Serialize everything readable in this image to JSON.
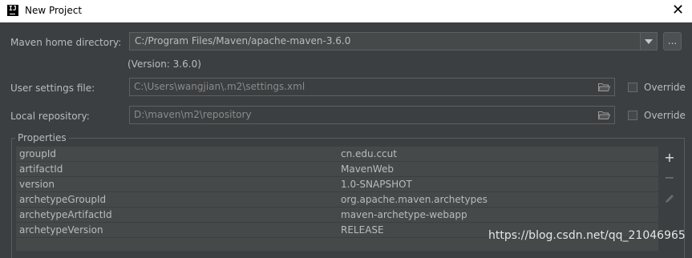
{
  "window": {
    "title": "New Project",
    "app_icon": "IJ"
  },
  "maven_home": {
    "label": "Maven home directory:",
    "value": "C:/Program Files/Maven/apache-maven-3.6.0",
    "version_note": "(Version: 3.6.0)",
    "browse_label": "..."
  },
  "user_settings": {
    "label": "User settings file:",
    "value": "C:\\Users\\wangjian\\.m2\\settings.xml",
    "override_label": "Override",
    "override_checked": false
  },
  "local_repo": {
    "label": "Local repository:",
    "value": "D:\\maven\\m2\\repository",
    "override_label": "Override",
    "override_checked": false
  },
  "properties": {
    "legend": "Properties",
    "rows": [
      {
        "key": "groupId",
        "value": "cn.edu.ccut"
      },
      {
        "key": "artifactId",
        "value": "MavenWeb"
      },
      {
        "key": "version",
        "value": "1.0-SNAPSHOT"
      },
      {
        "key": "archetypeGroupId",
        "value": "org.apache.maven.archetypes"
      },
      {
        "key": "archetypeArtifactId",
        "value": "maven-archetype-webapp"
      },
      {
        "key": "archetypeVersion",
        "value": "RELEASE"
      }
    ],
    "tools": [
      "add-icon",
      "remove-icon",
      "edit-icon"
    ]
  },
  "watermark": "https://blog.csdn.net/qq_21046965"
}
